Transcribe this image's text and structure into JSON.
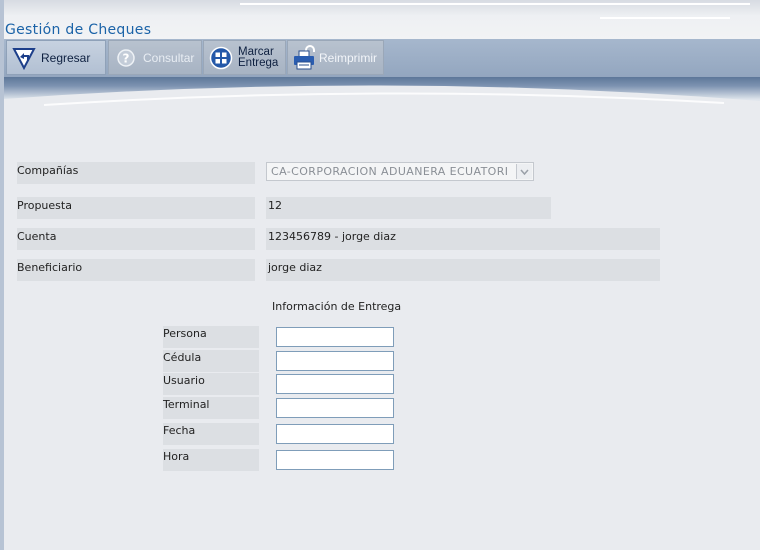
{
  "app": {
    "title": "Gestión de Cheques"
  },
  "toolbar": {
    "regresar": "Regresar",
    "consultar": "Consultar",
    "marcar_line1": "Marcar",
    "marcar_line2": "Entrega",
    "reimprimir": "Reimprimir"
  },
  "form": {
    "companias_label": "Compañías",
    "companias_value": "CA-CORPORACION ADUANERA ECUATORI",
    "propuesta_label": "Propuesta",
    "propuesta_value": "12",
    "cuenta_label": "Cuenta",
    "cuenta_value": "123456789 - jorge diaz",
    "beneficiario_label": "Beneficiario",
    "beneficiario_value": "jorge diaz"
  },
  "entrega": {
    "title": "Información de Entrega",
    "fields": [
      {
        "label": "Persona",
        "value": ""
      },
      {
        "label": "Cédula",
        "value": ""
      },
      {
        "label": "Usuario",
        "value": ""
      },
      {
        "label": "Terminal",
        "value": ""
      },
      {
        "label": "Fecha",
        "value": ""
      },
      {
        "label": "Hora",
        "value": ""
      }
    ]
  },
  "colors": {
    "title": "#1b63a8",
    "toolbar": "#9fb1c8",
    "field_bg": "#dcdfe3",
    "input_border": "#7f9db9"
  },
  "icons": {
    "regresar": "back-arrow-icon",
    "consultar": "help-icon",
    "marcar": "grid-check-icon",
    "reimprimir": "printer-lock-icon"
  }
}
